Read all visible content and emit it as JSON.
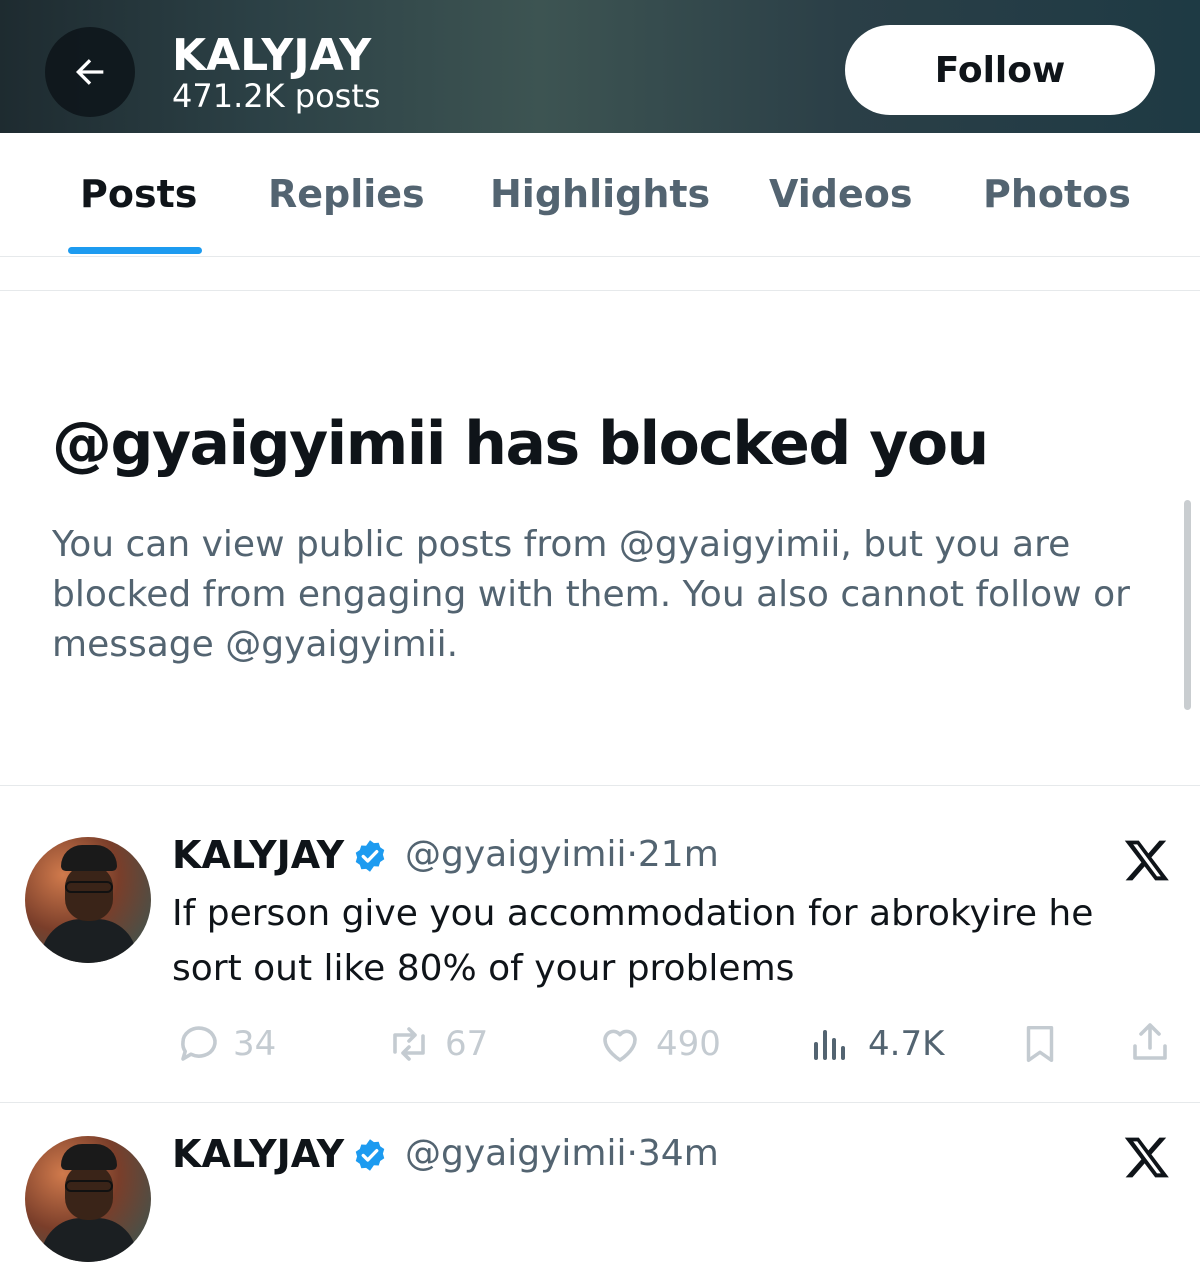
{
  "header": {
    "title": "KALYJAY",
    "subtitle": "471.2K posts",
    "follow_label": "Follow"
  },
  "tabs": [
    {
      "label": "Posts",
      "active": true
    },
    {
      "label": "Replies",
      "active": false
    },
    {
      "label": "Highlights",
      "active": false
    },
    {
      "label": "Videos",
      "active": false
    },
    {
      "label": "Photos",
      "active": false
    }
  ],
  "blocked": {
    "title": "@gyaigyimii has blocked you",
    "message": "You can view public posts from @gyaigyimii, but you are blocked from engaging with them. You also cannot follow or message @gyaigyimii."
  },
  "posts": [
    {
      "name": "KALYJAY",
      "handle": "@gyaigyimii",
      "separator": "·",
      "time": "21m",
      "text": "If person give you accommodation for abrokyire he sort out like 80% of your problems",
      "replies": "34",
      "reposts": "67",
      "likes": "490",
      "views": "4.7K"
    },
    {
      "name": "KALYJAY",
      "handle": "@gyaigyimii",
      "separator": "·",
      "time": "34m"
    }
  ],
  "icons": {
    "back": "arrow-left-icon",
    "verified": "verified-badge-icon",
    "x_logo": "x-logo-icon",
    "reply": "reply-icon",
    "repost": "repost-icon",
    "like": "like-icon",
    "views": "views-icon",
    "bookmark": "bookmark-icon",
    "share": "share-icon"
  },
  "colors": {
    "accent": "#1d9bf0",
    "text_primary": "#0f1419",
    "text_secondary": "#536471",
    "disabled_action": "#c4cbd1"
  }
}
